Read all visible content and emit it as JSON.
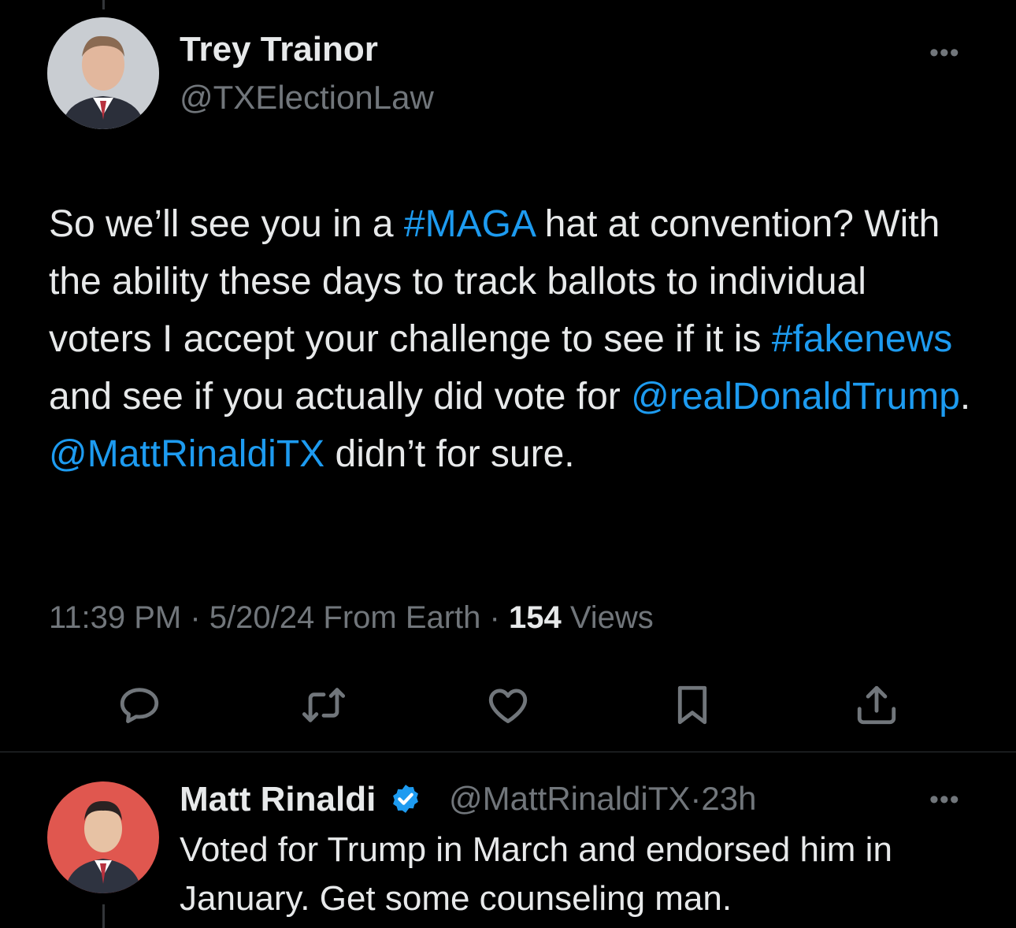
{
  "tweet": {
    "author_name": "Trey Trainor",
    "author_handle": "@TXElectionLaw",
    "more_label": "•••",
    "text_parts": [
      {
        "text": "So we’ll see you in a ",
        "link": false
      },
      {
        "text": "#MAGA",
        "link": true
      },
      {
        "text": " hat at convention? With the ability these days to track ballots to individual voters I accept your challenge to see if it is ",
        "link": false
      },
      {
        "text": "#fakenews",
        "link": true
      },
      {
        "text": " and see if you actually did vote for ",
        "link": false
      },
      {
        "text": "@realDonaldTrump",
        "link": true
      },
      {
        "text": ". ",
        "link": false
      },
      {
        "text": "@MattRinaldiTX",
        "link": true
      },
      {
        "text": " didn’t for sure.",
        "link": false
      }
    ],
    "time": "11:39 PM",
    "sep1": " · ",
    "date": "5/20/24",
    "source": " From Earth",
    "sep2": " · ",
    "views_count": "154",
    "views_label": " Views"
  },
  "actions": [
    {
      "name": "reply-icon"
    },
    {
      "name": "retweet-icon"
    },
    {
      "name": "like-icon"
    },
    {
      "name": "bookmark-icon"
    },
    {
      "name": "share-icon"
    }
  ],
  "reply": {
    "author_name": "Matt Rinaldi",
    "verified_icon": "verified-badge-icon",
    "author_handle": "@MattRinaldiTX",
    "time": "·23h",
    "more_label": "•••",
    "text": "Voted for Trump in March and endorsed him in January. Get some counseling man."
  },
  "colors": {
    "background": "#000000",
    "text": "#e7e9ea",
    "secondary": "#71767b",
    "link": "#1d9bf0",
    "divider": "#2f3336"
  }
}
